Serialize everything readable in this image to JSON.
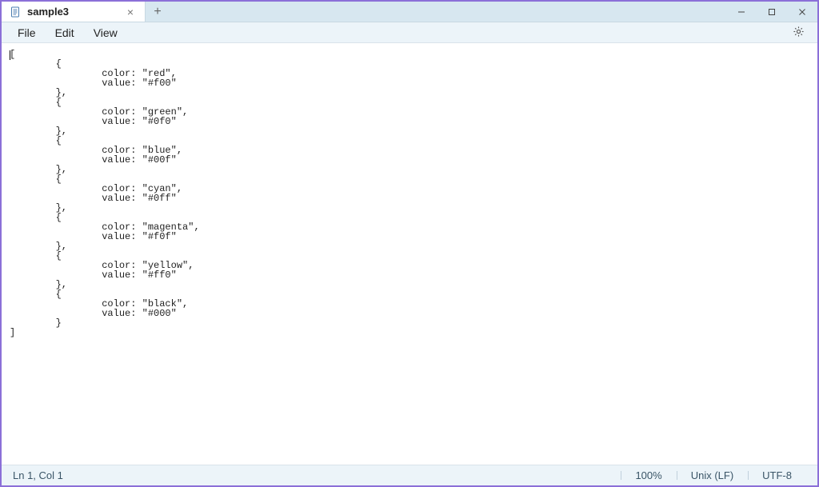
{
  "tab": {
    "title": "sample3"
  },
  "menu": {
    "file": "File",
    "edit": "Edit",
    "view": "View"
  },
  "editor": {
    "content": "[\n        {\n                color: \"red\",\n                value: \"#f00\"\n        },\n        {\n                color: \"green\",\n                value: \"#0f0\"\n        },\n        {\n                color: \"blue\",\n                value: \"#00f\"\n        },\n        {\n                color: \"cyan\",\n                value: \"#0ff\"\n        },\n        {\n                color: \"magenta\",\n                value: \"#f0f\"\n        },\n        {\n                color: \"yellow\",\n                value: \"#ff0\"\n        },\n        {\n                color: \"black\",\n                value: \"#000\"\n        }\n]"
  },
  "status": {
    "position": "Ln 1, Col 1",
    "zoom": "100%",
    "line_ending": "Unix (LF)",
    "encoding": "UTF-8"
  }
}
